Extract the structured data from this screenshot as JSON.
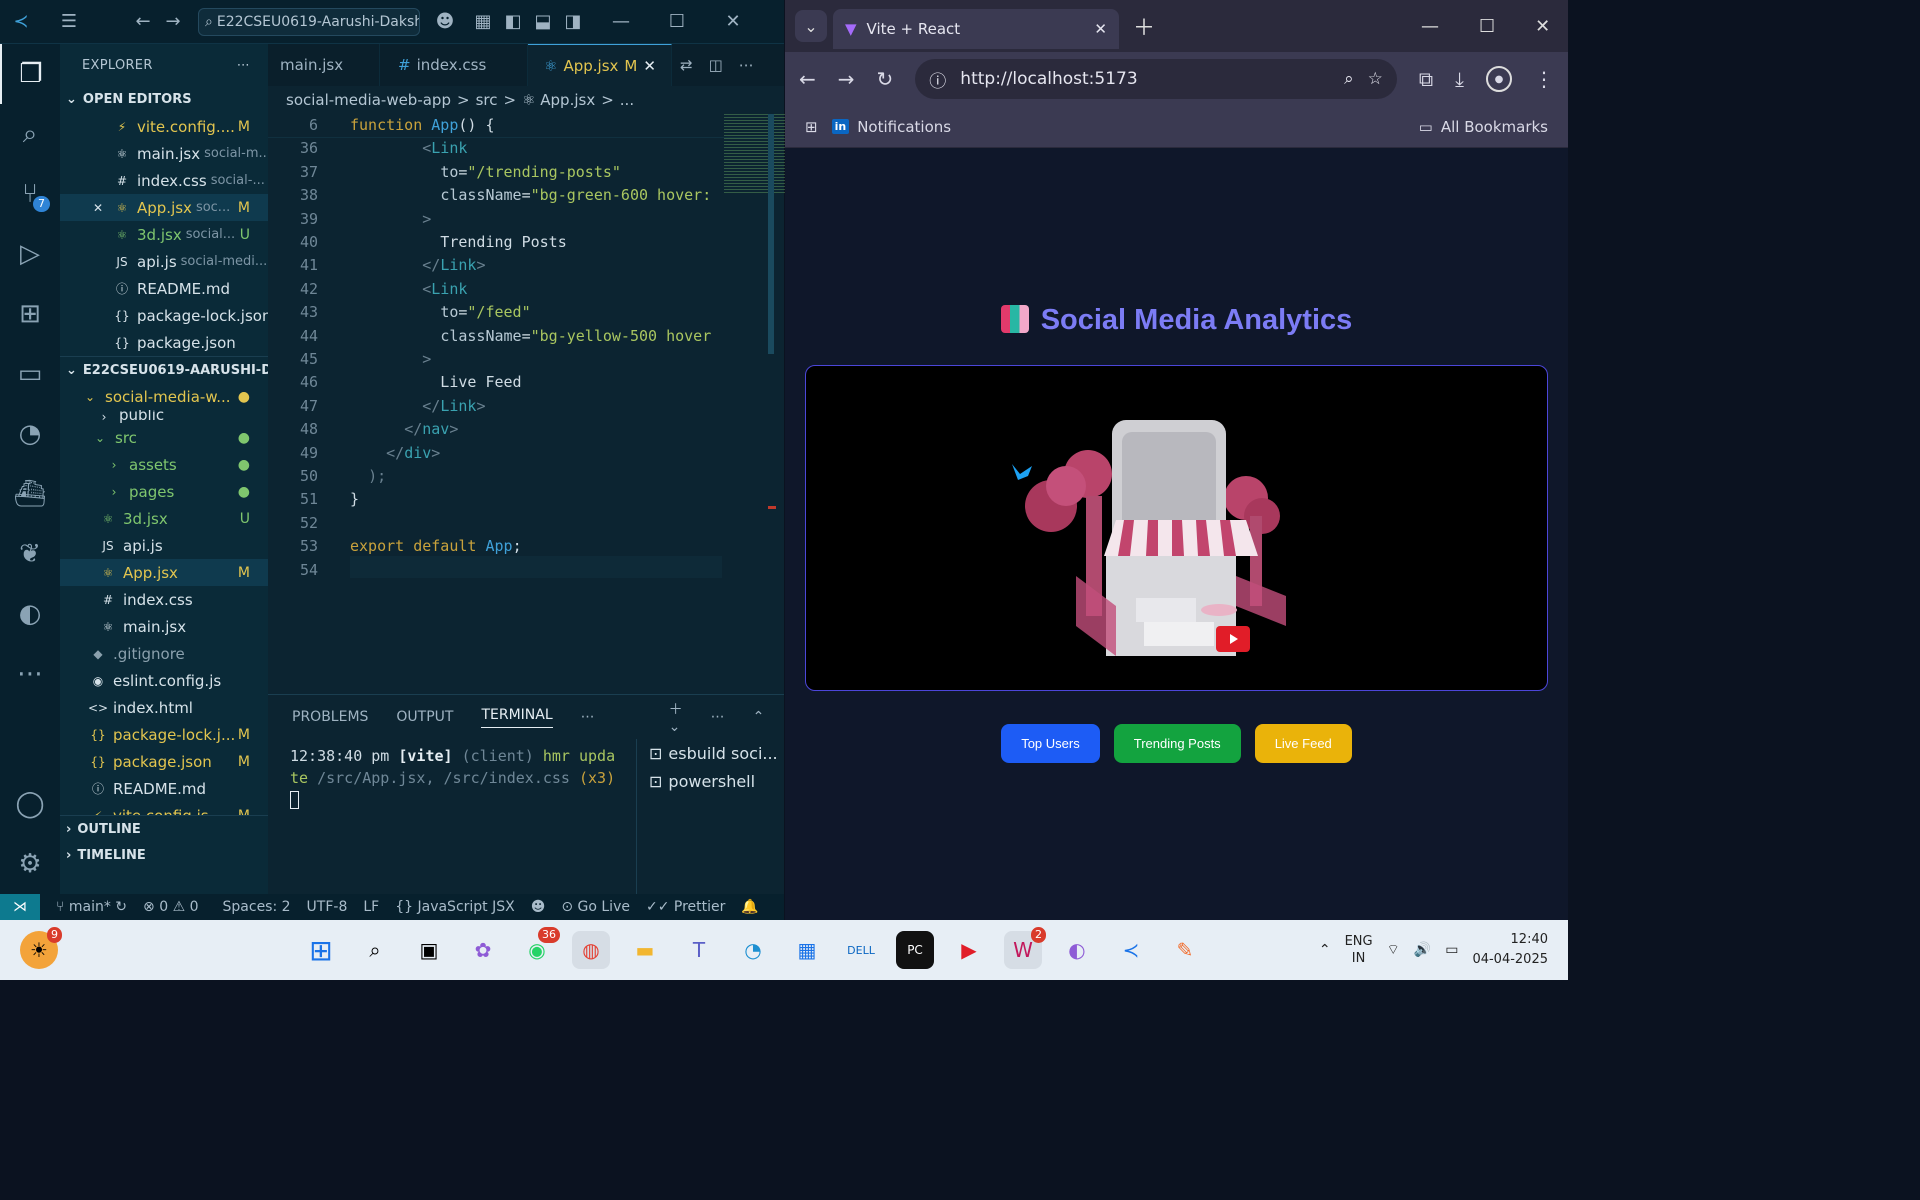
{
  "vscode": {
    "command_center": "E22CSEU0619-Aarushi-Daksh",
    "explorer_title": "EXPLORER",
    "open_editors_title": "OPEN EDITORS",
    "open_editors": [
      {
        "icon": "⚡",
        "name": "vite.config....",
        "sub": "",
        "status": "M",
        "cls": "yel",
        "close": ""
      },
      {
        "icon": "⚛",
        "name": "main.jsx",
        "sub": "social-m...",
        "status": "",
        "cls": "",
        "close": ""
      },
      {
        "icon": "#",
        "name": "index.css",
        "sub": "social-...",
        "status": "",
        "cls": "",
        "close": ""
      },
      {
        "icon": "⚛",
        "name": "App.jsx",
        "sub": "soc...",
        "status": "M",
        "cls": "yel",
        "close": "✕"
      },
      {
        "icon": "⚛",
        "name": "3d.jsx",
        "sub": "social...",
        "status": "U",
        "cls": "grn",
        "close": ""
      },
      {
        "icon": "JS",
        "name": "api.js",
        "sub": "social-medi...",
        "status": "",
        "cls": "",
        "close": ""
      },
      {
        "icon": "ⓘ",
        "name": "README.md",
        "sub": "",
        "status": "",
        "cls": "",
        "close": ""
      },
      {
        "icon": "{}",
        "name": "package-lock.json",
        "sub": "",
        "status": "",
        "cls": "",
        "close": ""
      },
      {
        "icon": "{}",
        "name": "package.json",
        "sub": "",
        "status": "",
        "cls": "",
        "close": ""
      }
    ],
    "workspace_title": "E22CSEU0619-AARUSHI-D...",
    "tree": [
      {
        "indent": 20,
        "icon": "⌄",
        "name": "social-media-w...",
        "status": "●",
        "cls": "yel"
      },
      {
        "indent": 34,
        "icon": "›",
        "name": "public",
        "status": "",
        "cls": ""
      },
      {
        "indent": 30,
        "icon": "⌄",
        "name": "src",
        "status": "●",
        "cls": "grn"
      },
      {
        "indent": 44,
        "icon": "›",
        "name": "assets",
        "status": "●",
        "cls": "grn"
      },
      {
        "indent": 44,
        "icon": "›",
        "name": "pages",
        "status": "●",
        "cls": "grn"
      },
      {
        "indent": 38,
        "icon": "⚛",
        "name": "3d.jsx",
        "status": "U",
        "cls": "grn"
      },
      {
        "indent": 38,
        "icon": "JS",
        "name": "api.js",
        "status": "",
        "cls": ""
      },
      {
        "indent": 38,
        "icon": "⚛",
        "name": "App.jsx",
        "status": "M",
        "cls": "yel"
      },
      {
        "indent": 38,
        "icon": "#",
        "name": "index.css",
        "status": "",
        "cls": ""
      },
      {
        "indent": 38,
        "icon": "⚛",
        "name": "main.jsx",
        "status": "",
        "cls": ""
      },
      {
        "indent": 28,
        "icon": "◆",
        "name": ".gitignore",
        "status": "",
        "cls": "gray"
      },
      {
        "indent": 28,
        "icon": "◉",
        "name": "eslint.config.js",
        "status": "",
        "cls": ""
      },
      {
        "indent": 28,
        "icon": "<>",
        "name": "index.html",
        "status": "",
        "cls": ""
      },
      {
        "indent": 28,
        "icon": "{}",
        "name": "package-lock.j...",
        "status": "M",
        "cls": "yel"
      },
      {
        "indent": 28,
        "icon": "{}",
        "name": "package.json",
        "status": "M",
        "cls": "yel"
      },
      {
        "indent": 28,
        "icon": "ⓘ",
        "name": "README.md",
        "status": "",
        "cls": ""
      },
      {
        "indent": 28,
        "icon": "⚡",
        "name": "vite.config.js",
        "status": "M",
        "cls": "yel"
      }
    ],
    "outline": "OUTLINE",
    "timeline": "TIMELINE",
    "tabs": [
      {
        "name": "main.jsx",
        "icon": "",
        "active": false
      },
      {
        "name": "index.css",
        "icon": "#",
        "active": false
      },
      {
        "name": "App.jsx",
        "icon": "⚛",
        "active": true,
        "status": "M"
      }
    ],
    "breadcrumb": [
      "social-media-web-app",
      ">",
      "src",
      ">",
      "⚛ App.jsx",
      ">",
      "..."
    ],
    "panel_tabs": [
      "PROBLEMS",
      "OUTPUT",
      "TERMINAL"
    ],
    "terminal_lines": [
      "12:38:40 pm [vite] (client) hmr upda",
      "te /src/App.jsx, /src/index.css (x3)"
    ],
    "terminals": [
      "esbuild soci...",
      "powershell"
    ],
    "status": {
      "branch": "main*",
      "errors": "0",
      "warnings": "0",
      "spaces": "Spaces: 2",
      "encoding": "UTF-8",
      "eol": "LF",
      "language": "JavaScript JSX",
      "golive": "Go Live",
      "prettier": "Prettier"
    },
    "scm_badge": "7"
  },
  "browser": {
    "tab_title": "Vite + React",
    "url": "http://localhost:5173",
    "bookmark": "Notifications",
    "all_bookmarks": "All Bookmarks",
    "page_title": "Social Media Analytics",
    "buttons": [
      {
        "label": "Top Users",
        "color": "#1d5cf5"
      },
      {
        "label": "Trending Posts",
        "color": "#13a33f"
      },
      {
        "label": "Live Feed",
        "color": "#eab30a"
      }
    ]
  },
  "taskbar": {
    "weather_badge": "9",
    "whatsapp_badge": "36",
    "app_badge": "2",
    "lang1": "ENG",
    "lang2": "IN",
    "time": "12:40",
    "date": "04-04-2025"
  }
}
